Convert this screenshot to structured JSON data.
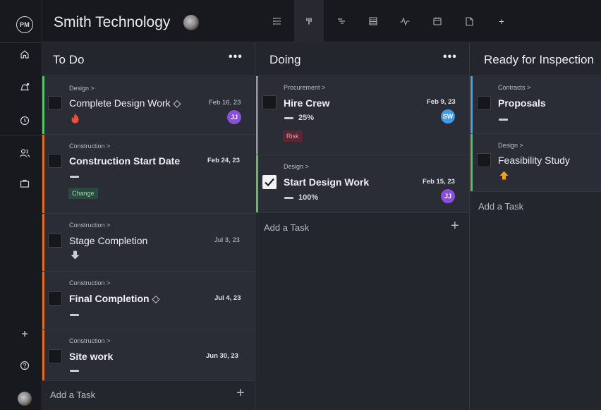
{
  "app": {
    "logo": "PM",
    "project_title": "Smith Technology"
  },
  "rail_icons": [
    "home-icon",
    "bulb-notification-icon",
    "clock-icon",
    "people-icon",
    "briefcase-icon",
    "plus-icon",
    "help-icon"
  ],
  "view_tabs": [
    "list-view-icon",
    "board-view-icon",
    "gantt-view-icon",
    "sheet-view-icon",
    "dashboard-view-icon",
    "calendar-view-icon",
    "files-view-icon",
    "add-view-icon"
  ],
  "add_view_label": "+",
  "columns": [
    {
      "title": "To Do",
      "more": "•••",
      "add_task": "Add a Task",
      "add_plus": "+",
      "cards": [
        {
          "crumb": "Design >",
          "name": "Complete Design Work ◇",
          "date": "Feb 16, 23",
          "assignee": "JJ",
          "priority": "fire",
          "stripe": "#58c26a"
        },
        {
          "crumb": "Construction >",
          "name": "Construction Start Date",
          "date": "Feb 24, 23",
          "priority": "dash",
          "tag": "Change",
          "stripe": "#e06d1a"
        },
        {
          "crumb": "Construction >",
          "name": "Stage Completion",
          "date": "Jul 3, 23",
          "priority": "down",
          "stripe": "#e06d1a"
        },
        {
          "crumb": "Construction >",
          "name": "Final Completion ◇",
          "date": "Jul 4, 23",
          "priority": "dash",
          "stripe": "#e06d1a"
        },
        {
          "crumb": "Construction >",
          "name": "Site work",
          "date": "Jun 30, 23",
          "priority": "dash",
          "stripe": "#e06d1a"
        }
      ]
    },
    {
      "title": "Doing",
      "more": "•••",
      "add_task": "Add a Task",
      "add_plus": "+",
      "cards": [
        {
          "crumb": "Procurement >",
          "name": "Hire Crew",
          "date": "Feb 9, 23",
          "assignee": "SW",
          "progress": "25%",
          "tag": "Risk",
          "stripe": "#9aa0a8"
        },
        {
          "crumb": "Design >",
          "name": "Start Design Work",
          "date": "Feb 15, 23",
          "assignee": "JJ",
          "progress": "100%",
          "checked": true,
          "stripe": "#58c26a"
        }
      ]
    },
    {
      "title": "Ready for Inspection",
      "add_task": "Add a Task",
      "cards": [
        {
          "crumb": "Contracts >",
          "name": "Proposals",
          "priority": "dash",
          "stripe": "#3aa9e6"
        },
        {
          "crumb": "Design >",
          "name": "Feasibility Study",
          "priority": "up",
          "stripe": "#58c26a"
        }
      ]
    }
  ],
  "colors": {
    "jj_avatar": "#8b4ddb",
    "sw_avatar": "#3e9bea",
    "change_tag_bg": "#294a3e",
    "change_tag_fg": "#9fd3b8",
    "risk_tag_bg": "#5a2532",
    "risk_tag_fg": "#e3a1ad",
    "fire": "#f0503a",
    "up_arrow": "#f5a11a"
  }
}
